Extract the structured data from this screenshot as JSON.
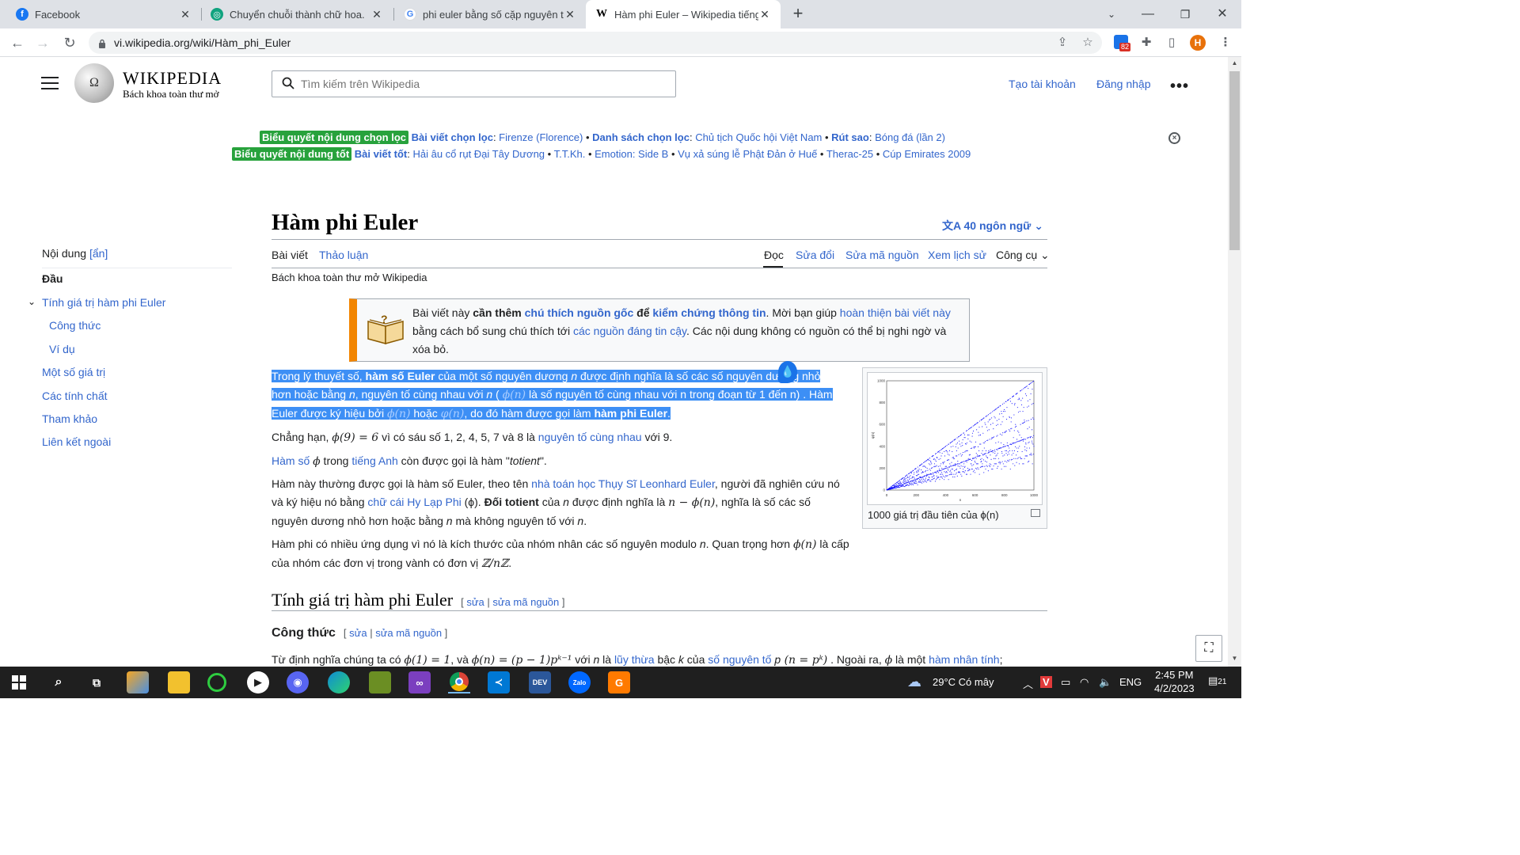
{
  "browser": {
    "tabs": [
      {
        "title": "Facebook",
        "icon": "facebook-icon",
        "color": "#1877f2",
        "glyph": "f"
      },
      {
        "title": "Chuyển chuỗi thành chữ hoa.",
        "icon": "chatgpt-icon",
        "color": "#10a37f",
        "glyph": "◎"
      },
      {
        "title": "phi euler bằng số cặp nguyên tố",
        "icon": "google-icon",
        "color": "#4285f4",
        "glyph": "G"
      },
      {
        "title": "Hàm phi Euler – Wikipedia tiếng",
        "icon": "wikipedia-icon",
        "color": "#000000",
        "glyph": "W"
      }
    ],
    "url": "vi.wikipedia.org/wiki/Hàm_phi_Euler",
    "ext_badge": "82",
    "profile_initial": "H"
  },
  "header": {
    "wordmark": "WIKIPEDIA",
    "tagline": "Bách khoa toàn thư mở",
    "search_placeholder": "Tìm kiếm trên Wikipedia",
    "create_account": "Tạo tài khoản",
    "login": "Đăng nhập"
  },
  "notice": {
    "badge1": "Biểu quyết nội dung chọn lọc",
    "line1": [
      {
        "label": "Bài viết chọn lọc",
        "value": "Firenze (Florence)"
      },
      {
        "label": "Danh sách chọn lọc",
        "value": "Chủ tịch Quốc hội Việt Nam"
      },
      {
        "label": "Rút sao",
        "value": "Bóng đá (lần 2)"
      }
    ],
    "badge2": "Biểu quyết nội dung tốt",
    "line2_label": "Bài viết tốt",
    "line2_items": [
      "Hải âu cổ rụt Đại Tây Dương",
      "T.T.Kh.",
      "Emotion: Side B",
      "Vụ xả súng lễ Phật Đản ở Huế",
      "Therac-25",
      "Cúp Emirates 2009"
    ]
  },
  "toc": {
    "title": "Nội dung",
    "hide": "[ẩn]",
    "items": [
      "Đầu",
      "Tính giá trị hàm phi Euler",
      "Công thức",
      "Ví dụ",
      "Một số giá trị",
      "Các tính chất",
      "Tham khảo",
      "Liên kết ngoài"
    ]
  },
  "article": {
    "title": "Hàm phi Euler",
    "languages": "40 ngôn ngữ",
    "tab_article": "Bài viết",
    "tab_talk": "Thảo luận",
    "tab_read": "Đọc",
    "tab_edit": "Sửa đổi",
    "tab_edit_source": "Sửa mã nguồn",
    "tab_history": "Xem lịch sử",
    "tab_tools": "Công cụ",
    "tagline": "Bách khoa toàn thư mở Wikipedia",
    "ambox": {
      "t1": "Bài viết này ",
      "b1": "cần thêm ",
      "l1": "chú thích nguồn gốc",
      "b2": " để ",
      "l2": "kiểm chứng thông tin",
      "t2": ". Mời bạn giúp ",
      "l3": "hoàn thiện bài viết này",
      "t3": " bằng cách bổ sung chú thích tới ",
      "l4": "các nguồn đáng tin cậy",
      "t4": ". Các nội dung không có nguồn có thể bị nghi ngờ và xóa bỏ."
    },
    "p1": {
      "a": "Trong lý thuyết số, ",
      "b": "hàm số Euler",
      "c": " của một số nguyên dương ",
      "n1": "n",
      "d": " được định nghĩa là số các số nguyên dương nhỏ hơn hoặc bằng ",
      "n2": "n",
      "e": ", nguyên tố cùng nhau với ",
      "n3": "n",
      "f": " ( ",
      "m1": "ϕ(n)",
      "g": " là số nguyên tố cùng nhau với n trong đoạn từ 1 đến n) . Hàm Euler được ký hiệu bởi ",
      "m2": "ϕ(n)",
      "h": " hoặc ",
      "m3": "φ(n)",
      "i": ", do đó hàm được gọi làm ",
      "j": "hàm phi Euler",
      "k": "."
    },
    "p2": {
      "a": "Chẳng hạn, ",
      "m": "ϕ(9) = 6",
      "b": " vì có sáu số 1, 2, 4, 5, 7 và 8 là ",
      "l": "nguyên tố cùng nhau",
      "c": " với 9."
    },
    "p3": {
      "l1": "Hàm số",
      "m": "ϕ",
      "a": " trong ",
      "l2": "tiếng Anh",
      "b": " còn được gọi là hàm \"",
      "i": "totient",
      "c": "\"."
    },
    "p4": {
      "a": "Hàm này thường được gọi là hàm số Euler, theo tên ",
      "l1": "nhà toán học Thụy Sĩ Leonhard Euler",
      "b": ", người đã nghiên cứu nó và ký hiệu nó bằng ",
      "l2": "chữ cái Hy Lạp Phi",
      "c": " (ϕ). ",
      "bold": "Đối totient",
      "d": " của ",
      "n1": "n",
      "e": " được định nghĩa là ",
      "m": "n − ϕ(n)",
      "f": ", nghĩa là số các số nguyên dương nhỏ hơn hoặc bằng ",
      "n2": "n",
      "g": " mà không nguyên tố với ",
      "n3": "n",
      "h": "."
    },
    "p5": {
      "a": "Hàm phi có nhiều ứng dụng vì nó là kích thước của nhóm nhân các số nguyên modulo ",
      "n": "n",
      "b": ". Quan trọng hơn ",
      "m1": "ϕ(n)",
      "c": " là cấp của nhóm các đơn vị trong vành có đơn vị ",
      "m2": "ℤ/nℤ",
      "d": "."
    },
    "thumb_caption": "1000 giá trị đầu tiên của ϕ(n)",
    "h2": "Tính giá trị hàm phi Euler",
    "h3": "Công thức",
    "edit": "sửa",
    "edit_source": "sửa mã nguồn",
    "p6": {
      "a": "Từ định nghĩa chúng ta có ",
      "m1": "ϕ(1) = 1",
      "b": ", và ",
      "m2": "ϕ(n) = (p − 1)pᵏ⁻¹",
      "c": " với ",
      "n": "n",
      "d": " là ",
      "l1": "lũy thừa",
      "e": " bậc ",
      "k": "k",
      "f": " của ",
      "l2": "số nguyên tố",
      "p": " p",
      "m3": " (n = pᵏ)",
      "g": " . Ngoài ra, ",
      "m4": "ϕ",
      "h": " là một ",
      "l3": "hàm nhân tính",
      "i": ";"
    }
  },
  "chart_data": {
    "type": "scatter",
    "xlim": [
      0,
      1000
    ],
    "ylim": [
      0,
      1000
    ],
    "x_ticks": [
      "0",
      "200",
      "400",
      "600",
      "800",
      "1000"
    ],
    "y_ticks": [
      "0",
      "200",
      "400",
      "600",
      "800",
      "1000"
    ],
    "xlabel": "n",
    "ylabel": "φ(n)",
    "series_color": "#0000ff",
    "description_series": "phi(n) for n = 1..1000"
  },
  "taskbar": {
    "weather": "29°C  Có mây",
    "lang": "ENG",
    "time": "2:45 PM",
    "date": "4/2/2023",
    "notif": "21"
  }
}
